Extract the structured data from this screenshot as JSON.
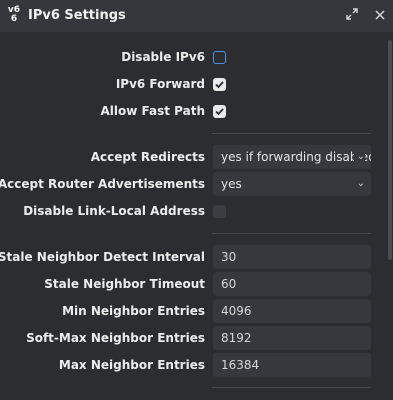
{
  "window": {
    "icon_line1": "v6",
    "icon_line2": "6",
    "title": "IPv6 Settings"
  },
  "basic": {
    "disable_ipv6_label": "Disable IPv6",
    "disable_ipv6_checked": false,
    "ipv6_forward_label": "IPv6 Forward",
    "ipv6_forward_checked": true,
    "allow_fast_path_label": "Allow Fast Path",
    "allow_fast_path_checked": true
  },
  "router": {
    "accept_redirects_label": "Accept Redirects",
    "accept_redirects_value": "yes if forwarding disabled",
    "accept_ra_label": "Accept Router Advertisements",
    "accept_ra_value": "yes",
    "disable_link_local_label": "Disable Link-Local Address",
    "disable_link_local_checked": false
  },
  "neighbor": {
    "stale_detect_label": "Stale Neighbor Detect Interval",
    "stale_detect_value": "30",
    "stale_timeout_label": "Stale Neighbor Timeout",
    "stale_timeout_value": "60",
    "min_entries_label": "Min Neighbor Entries",
    "min_entries_value": "4096",
    "soft_max_entries_label": "Soft-Max Neighbor Entries",
    "soft_max_entries_value": "8192",
    "max_entries_label": "Max Neighbor Entries",
    "max_entries_value": "16384"
  },
  "colors": {
    "background": "#2b2d31",
    "titlebar": "#35373c",
    "accent": "#4a90e2",
    "field": "#36383d"
  }
}
